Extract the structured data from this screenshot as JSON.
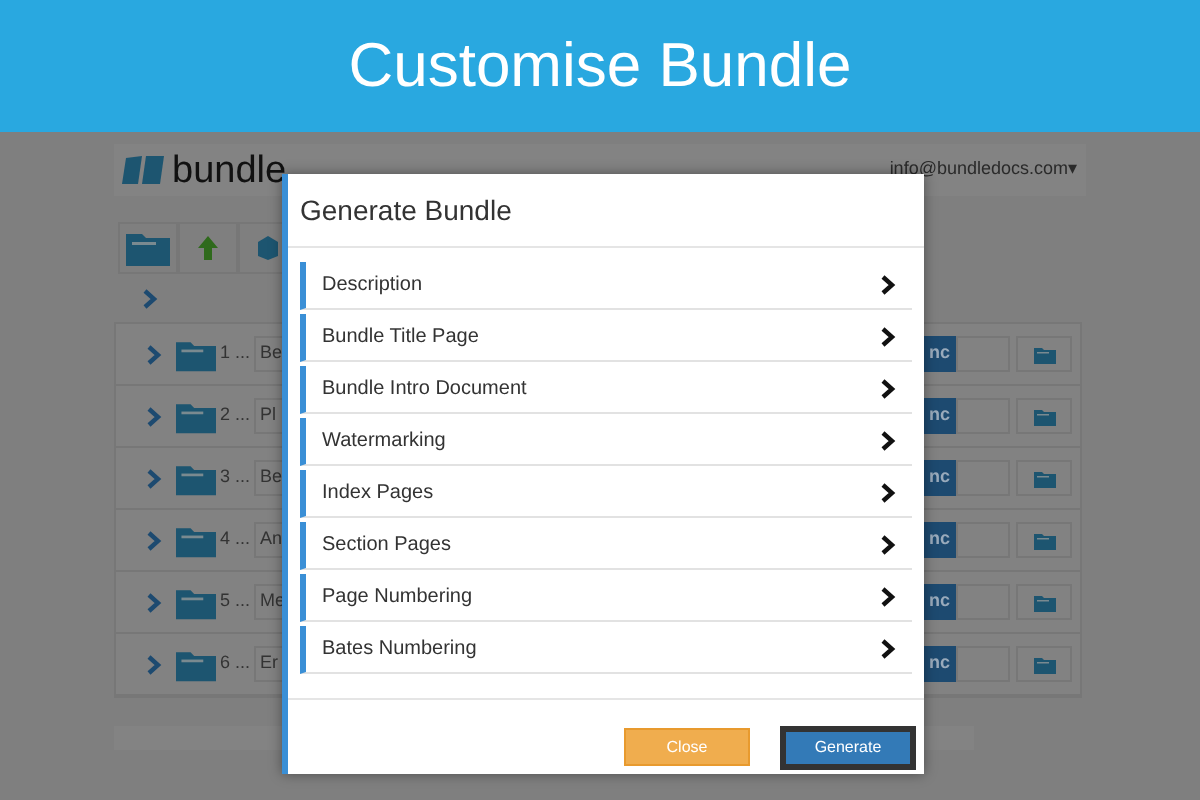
{
  "banner": {
    "title": "Customise Bundle"
  },
  "app": {
    "logo_text": "bundle",
    "account": "info@bundledocs.com▾",
    "rows": [
      {
        "number": "1 ...",
        "name": "Be",
        "action": "nc"
      },
      {
        "number": "2 ...",
        "name": "Pl",
        "action": "nc"
      },
      {
        "number": "3 ...",
        "name": "Be",
        "action": "nc"
      },
      {
        "number": "4 ...",
        "name": "An",
        "action": "nc"
      },
      {
        "number": "5 ...",
        "name": "Me",
        "action": "nc"
      },
      {
        "number": "6 ...",
        "name": "Er",
        "action": "nc"
      }
    ]
  },
  "dialog": {
    "title": "Generate Bundle",
    "items": [
      "Description",
      "Bundle Title Page",
      "Bundle Intro Document",
      "Watermarking",
      "Index Pages",
      "Section Pages",
      "Page Numbering",
      "Bates Numbering"
    ],
    "buttons": [
      {
        "label": "Close",
        "kind": "secondary"
      },
      {
        "label": "Generate",
        "kind": "primary"
      }
    ]
  }
}
